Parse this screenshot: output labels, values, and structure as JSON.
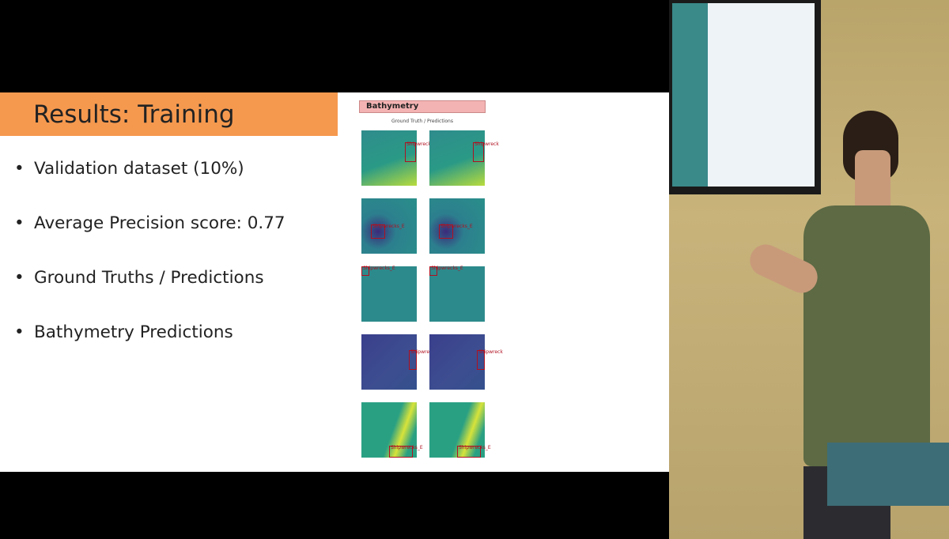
{
  "slide": {
    "title": "Results: Training",
    "bullets": [
      "Validation dataset (10%)",
      "Average Precision score: 0.77",
      "Ground Truths / Predictions",
      "Bathymetry Predictions"
    ],
    "figure": {
      "header": "Bathymetry",
      "subtitle": "Ground Truth / Predictions",
      "rows": [
        {
          "label": "Shipwreck",
          "style": "light"
        },
        {
          "label": "Shipwrecks_E",
          "style": "mid"
        },
        {
          "label": "Shipwrecks_E",
          "style": "flat"
        },
        {
          "label": "Shipwreck",
          "style": "dark"
        },
        {
          "label": "Shipwrecks_E",
          "style": "bright"
        }
      ]
    }
  },
  "colors": {
    "title_bar": "#f5994f",
    "header_fill": "#f4b3b3",
    "box": "#b01020"
  }
}
